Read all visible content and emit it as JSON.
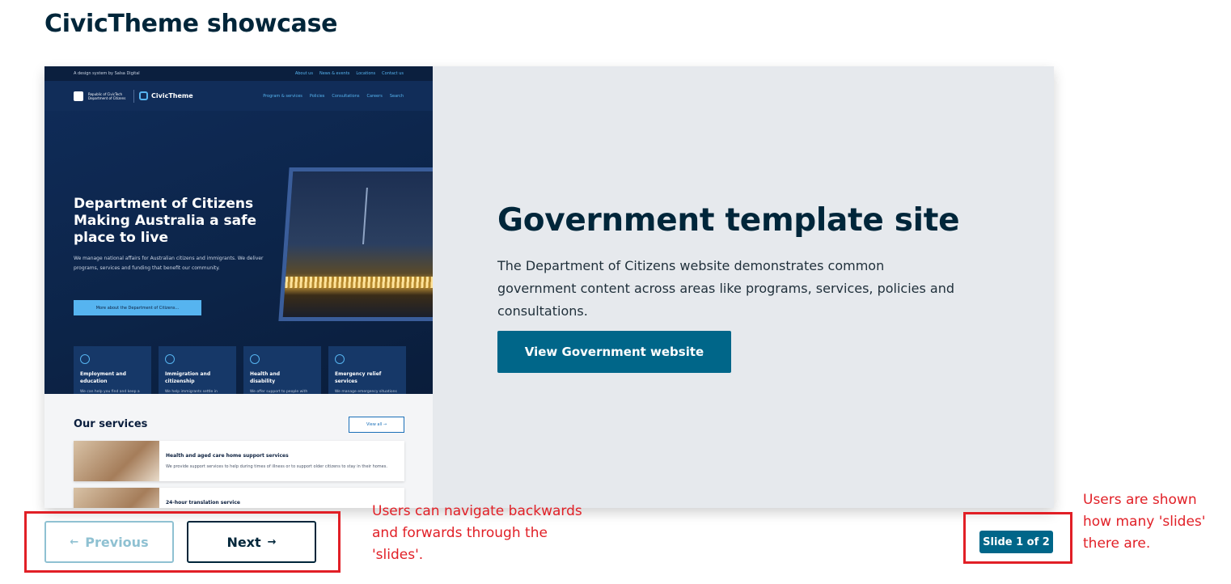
{
  "page": {
    "title": "CivicTheme showcase"
  },
  "slide": {
    "title": "Government template site",
    "description": "The Department of Citizens website demonstrates common government content across areas like programs, services, policies and consultations.",
    "button_label": "View Government website",
    "preview": {
      "topbar_left": "A design system by Salsa Digital",
      "topbar_links": [
        "About us",
        "News & events",
        "Locations",
        "Contact us"
      ],
      "dept_name": "Republic of CivicTech Department of Citizens",
      "logo_text": "CivicTheme",
      "menu": [
        "Program & services",
        "Policies",
        "Consultations",
        "Careers",
        "Search"
      ],
      "hero_title": "Department of Citizens Making Australia a safe place to live",
      "hero_lead": "We manage national affairs for Australian citizens and immigrants. We deliver programs, services and funding that benefit our community.",
      "hero_cta": "More about the Department of Citizens...",
      "cards": [
        {
          "title": "Employment and education",
          "desc": "We can help you find and keep a job through employment training services."
        },
        {
          "title": "Immigration and citizenship",
          "desc": "We help immigrants settle in Australia and run the citizenship process and ceremonies."
        },
        {
          "title": "Health and disability",
          "desc": "We offer support to people with disabilities and older Australians who need a little bit of help."
        },
        {
          "title": "Emergency relief services",
          "desc": "We manage emergency situations and can also help you with funding during natural disasters."
        }
      ],
      "services_title": "Our services",
      "view_all": "View all →",
      "items": [
        {
          "title": "Health and aged care home support services",
          "desc": "We provide support services to help during times of illness or to support older citizens to stay in their homes."
        },
        {
          "title": "24-hour translation service",
          "desc": ""
        }
      ]
    }
  },
  "controls": {
    "previous_label": "Previous",
    "previous_arrow": "←",
    "next_label": "Next",
    "next_arrow": "→",
    "counter": "Slide 1 of 2"
  },
  "annotations": {
    "navigation_note": "Users can navigate backwards and forwards through the 'slides'.",
    "counter_note": "Users are shown how many 'slides' there are."
  },
  "colors": {
    "primary": "#006689",
    "heading": "#00263a",
    "annotation": "#e11f26",
    "slide_bg": "#e6e9ed"
  }
}
